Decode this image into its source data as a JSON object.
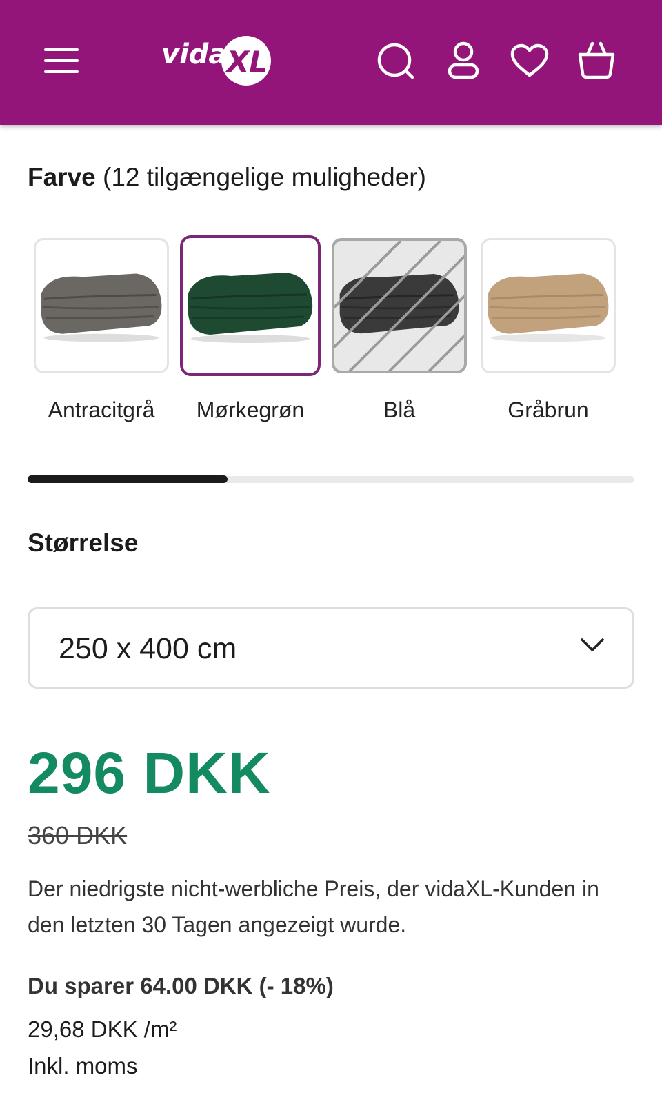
{
  "header": {
    "background": "#931579",
    "logo_text": "vidaXL",
    "icons": [
      "menu-icon",
      "search-icon",
      "account-icon",
      "heart-icon",
      "basket-icon"
    ]
  },
  "color_section": {
    "title_bold": "Farve",
    "title_rest": " (12 tilgængelige muligheder)",
    "swatches": [
      {
        "label": "Antracitgrå",
        "color": "#6b6864",
        "state": "available"
      },
      {
        "label": "Mørkegrøn",
        "color": "#1f4a32",
        "state": "selected"
      },
      {
        "label": "Blå",
        "color": "#3a3a3a",
        "state": "unavailable"
      },
      {
        "label": "Gråbrun",
        "color": "#c2a27c",
        "state": "available"
      }
    ],
    "selected_accent": "#7b2777",
    "scroll_progress": 0.33
  },
  "size_section": {
    "title": "Størrelse",
    "selected_value": "250 x 400 cm"
  },
  "pricing": {
    "price": "296 DKK",
    "price_color": "#148a60",
    "old_price": "360 DKK",
    "note": "Der niedrigste nicht-werbliche Preis, der vidaXL-Kunden in den letzten 30 Tagen angezeigt wurde.",
    "saving": "Du sparer 64.00 DKK (- 18%)",
    "unit_price": "29,68 DKK /m²",
    "vat": "Inkl. moms"
  }
}
